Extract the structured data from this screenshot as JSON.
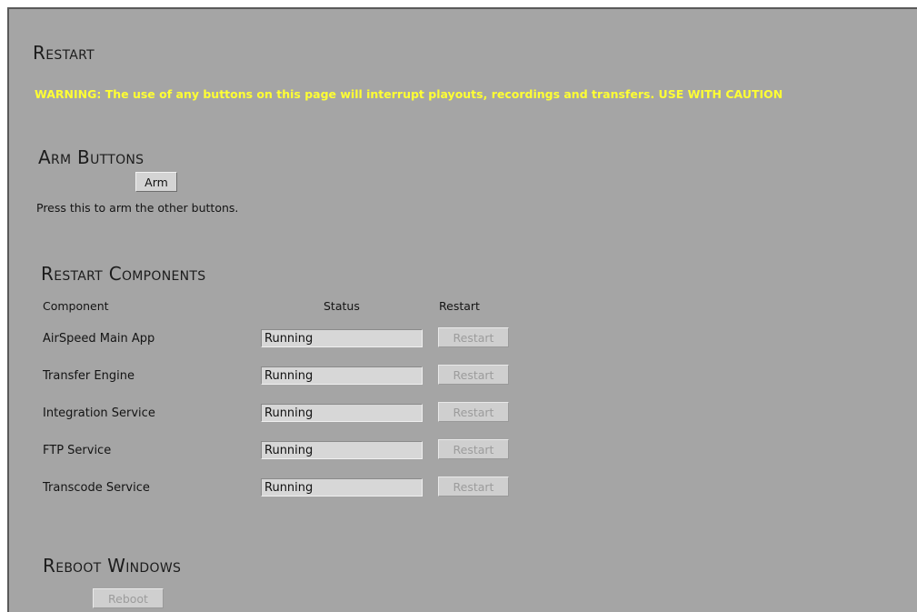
{
  "page": {
    "title": "Restart",
    "warning": "WARNING: The use of any buttons on this page will interrupt playouts, recordings and transfers. USE WITH CAUTION"
  },
  "arm": {
    "heading": "Arm Buttons",
    "button_label": "Arm",
    "hint": "Press this to arm the other buttons."
  },
  "components": {
    "heading": "Restart Components",
    "columns": [
      "Component",
      "Status",
      "Restart"
    ],
    "rows": [
      {
        "name": "AirSpeed Main App",
        "status": "Running",
        "action": "Restart"
      },
      {
        "name": "Transfer Engine",
        "status": "Running",
        "action": "Restart"
      },
      {
        "name": "Integration Service",
        "status": "Running",
        "action": "Restart"
      },
      {
        "name": "FTP Service",
        "status": "Running",
        "action": "Restart"
      },
      {
        "name": "Transcode Service",
        "status": "Running",
        "action": "Restart"
      }
    ]
  },
  "reboot": {
    "heading": "Reboot Windows",
    "button_label": "Reboot"
  },
  "colors": {
    "panel_background": "#a5a5a5",
    "warning_text": "#ffff33",
    "heading_text": "#1c1c1c"
  }
}
